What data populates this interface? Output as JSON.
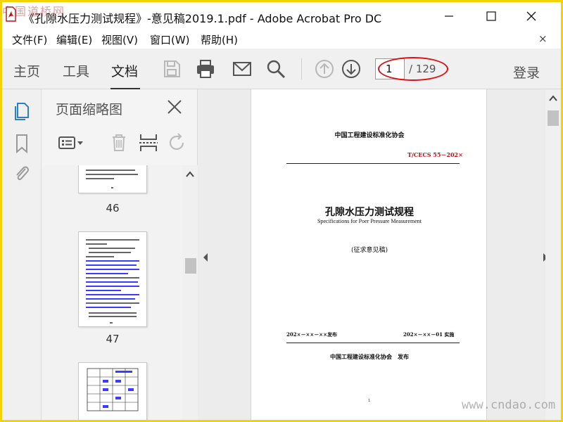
{
  "window": {
    "title": "《孔隙水压力测试规程》-意见稿2019.1.pdf - Adobe Acrobat Pro DC"
  },
  "watermarks": {
    "top_left": "中国道桥网",
    "bottom_right": "www.cndao.com"
  },
  "menu": {
    "items": [
      "文件(F)",
      "编辑(E)",
      "视图(V)",
      "窗口(W)",
      "帮助(H)"
    ],
    "close": "×"
  },
  "toolbar": {
    "tabs": [
      "主页",
      "工具",
      "文档"
    ],
    "active_tab": "文档",
    "icons": [
      "save-icon",
      "print-icon",
      "email-icon",
      "search-icon",
      "prev-page-icon",
      "next-page-icon"
    ],
    "page_current": "1",
    "page_total": "/ 129",
    "login": "登录"
  },
  "left_strip": {
    "icons": [
      "pages-icon",
      "bookmark-icon",
      "attachment-icon"
    ]
  },
  "thumbnail_panel": {
    "title": "页面缩略图",
    "tools": [
      "thumbnail-options-icon",
      "delete-icon",
      "insert-page-icon",
      "rotate-icon"
    ],
    "thumbnails": [
      {
        "page": "46"
      },
      {
        "page": "47"
      },
      {
        "page": ""
      }
    ]
  },
  "document": {
    "org_header": "中国工程建设标准化协会",
    "std_code": "T/CECS 55－202×",
    "title_cn": "孔隙水压力测试规程",
    "title_en": "Specifications for Poer Pressure Measurement",
    "draft_note": "(征求意见稿)",
    "issue_date": "202×－××－××发布",
    "impl_date": "202×－××－01 实施",
    "publisher": "中国工程建设标准化协会　发布",
    "page_number": "1"
  },
  "colors": {
    "frame": "#f5d300",
    "annotation_red": "#e01010",
    "code_red": "#c01010"
  }
}
